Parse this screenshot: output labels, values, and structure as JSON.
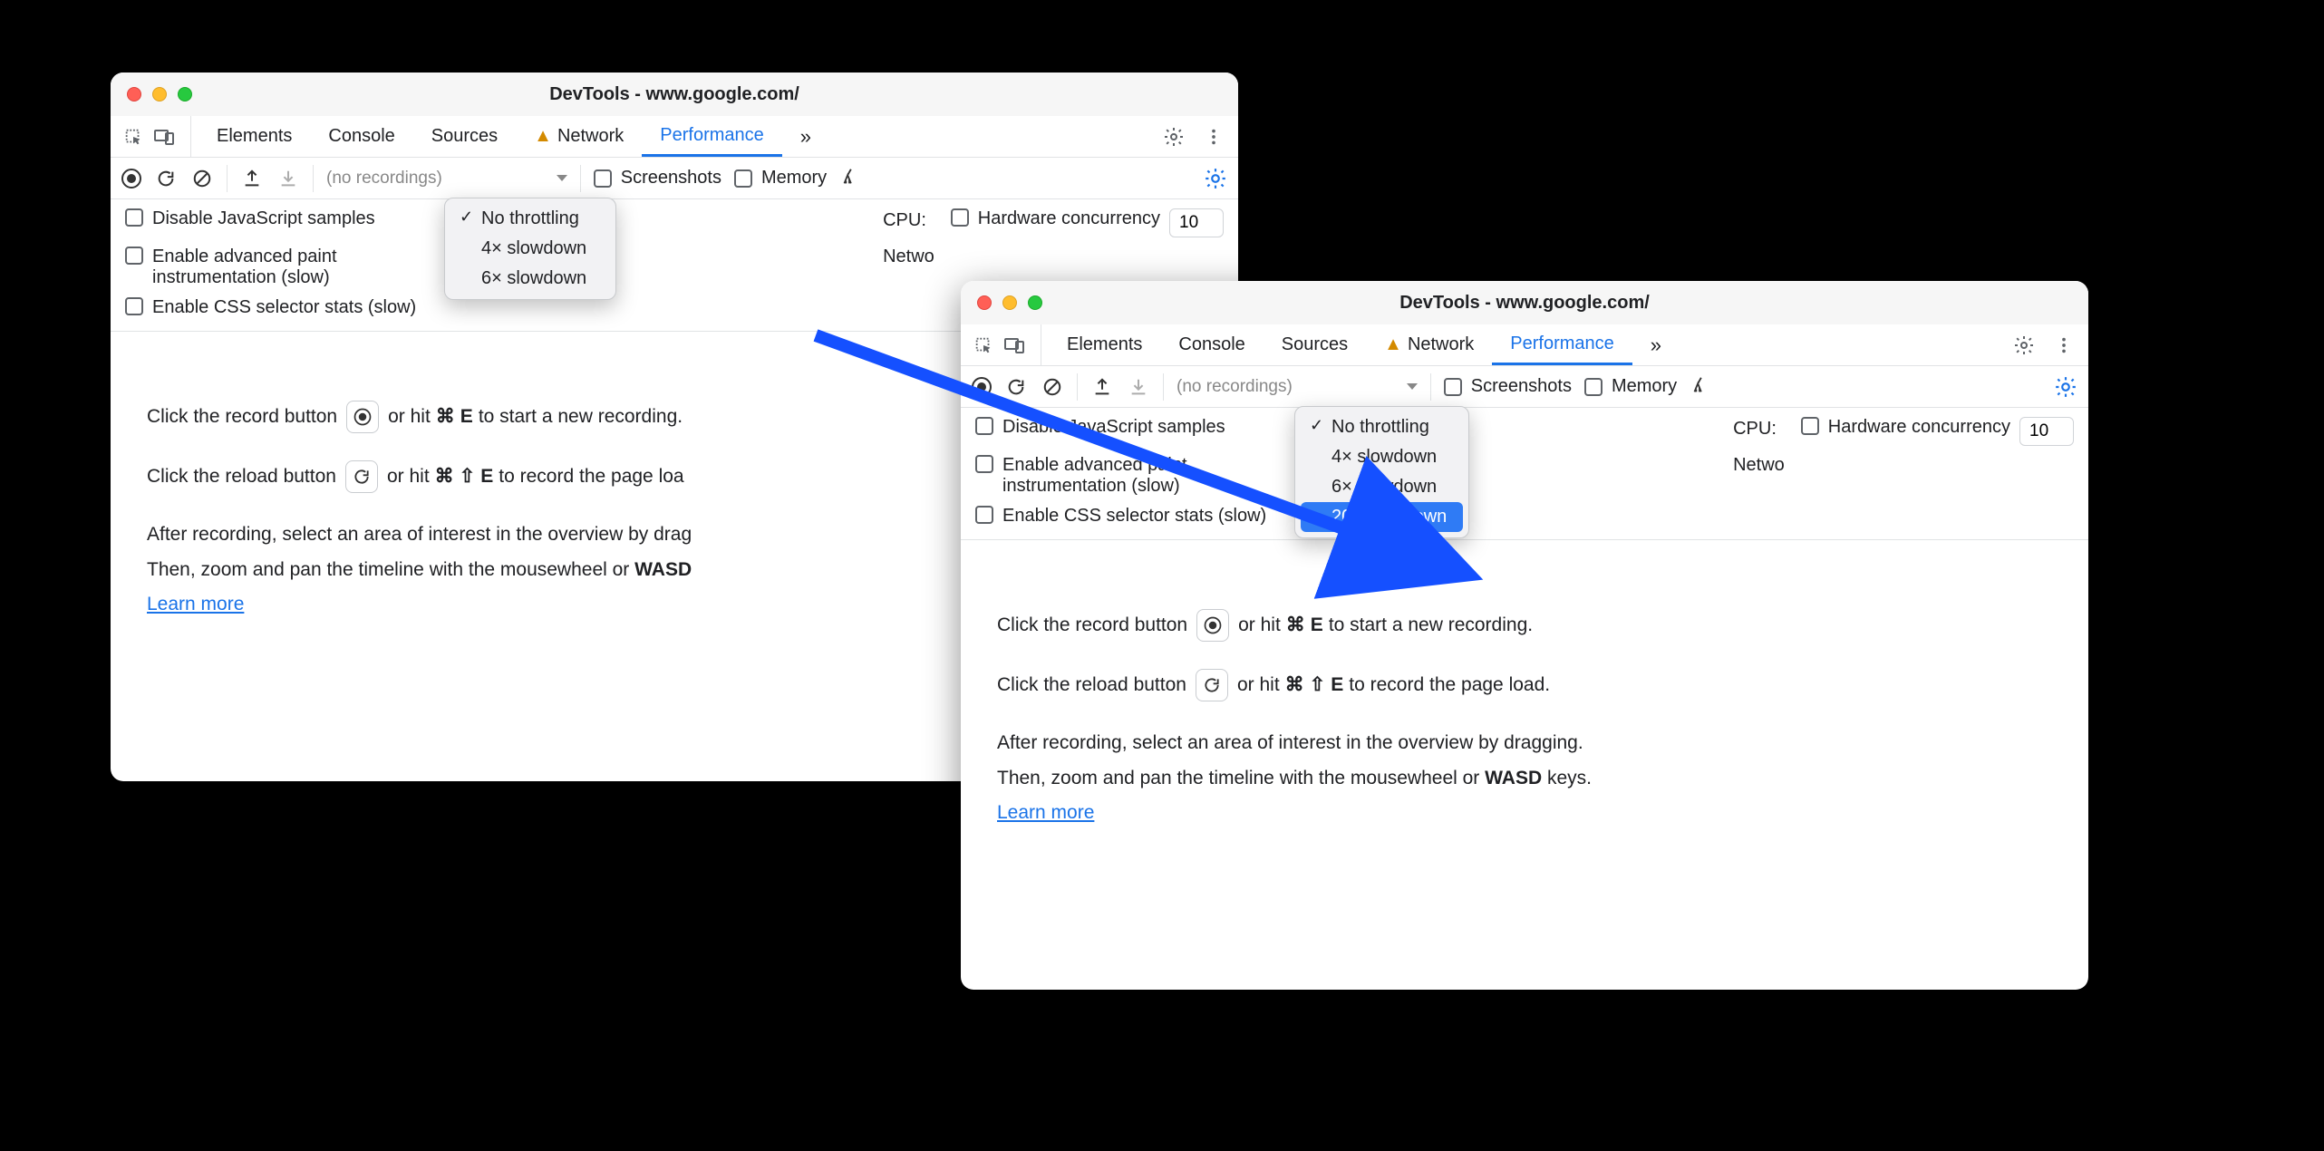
{
  "windowA": {
    "title": "DevTools - www.google.com/",
    "tabs": [
      "Elements",
      "Console",
      "Sources",
      "Network",
      "Performance"
    ],
    "activeTab": "Performance",
    "toolbar": {
      "noRecordings": "(no recordings)",
      "screenshots": "Screenshots",
      "memory": "Memory"
    },
    "settings": {
      "disableJS": "Disable JavaScript samples",
      "advPaint": "Enable advanced paint instrumentation (slow)",
      "cssSelector": "Enable CSS selector stats (slow)",
      "cpuLabel": "CPU:",
      "networkLabel": "Netwo",
      "hardwareConcurrency": "Hardware concurrency",
      "hardwareValue": "10"
    },
    "cpuDropdown": {
      "items": [
        "No throttling",
        "4× slowdown",
        "6× slowdown"
      ],
      "checkedIndex": 0,
      "highlightIndex": -1
    },
    "instructions": {
      "recordLine_pre": "Click the record button",
      "recordLine_post": "or hit",
      "recordShortcut_mod": "⌘",
      "recordShortcut_key": "E",
      "recordLine_end": "to start a new recording.",
      "reloadLine_pre": "Click the reload button",
      "reloadLine_post": "or hit",
      "reloadShortcut_mod": "⌘",
      "reloadShortcut_shift": "⇧",
      "reloadShortcut_key": "E",
      "reloadLine_end": "to record the page loa",
      "tip1": "After recording, select an area of interest in the overview by drag",
      "tip2_pre": "Then, zoom and pan the timeline with the mousewheel or ",
      "tip2_bold": "WASD",
      "learnMore": "Learn more"
    }
  },
  "windowB": {
    "title": "DevTools - www.google.com/",
    "tabs": [
      "Elements",
      "Console",
      "Sources",
      "Network",
      "Performance"
    ],
    "activeTab": "Performance",
    "toolbar": {
      "noRecordings": "(no recordings)",
      "screenshots": "Screenshots",
      "memory": "Memory"
    },
    "settings": {
      "disableJS": "Disable JavaScript samples",
      "advPaint": "Enable advanced paint instrumentation (slow)",
      "cssSelector": "Enable CSS selector stats (slow)",
      "cpuLabel": "CPU:",
      "networkLabel": "Netwo",
      "hardwareConcurrency": "Hardware concurrency",
      "hardwareValue": "10"
    },
    "cpuDropdown": {
      "items": [
        "No throttling",
        "4× slowdown",
        "6× slowdown",
        "20× slowdown"
      ],
      "checkedIndex": 0,
      "highlightIndex": 3
    },
    "instructions": {
      "recordLine_pre": "Click the record button",
      "recordLine_post": "or hit",
      "recordShortcut_mod": "⌘",
      "recordShortcut_key": "E",
      "recordLine_end": "to start a new recording.",
      "reloadLine_pre": "Click the reload button",
      "reloadLine_post": "or hit",
      "reloadShortcut_mod": "⌘",
      "reloadShortcut_shift": "⇧",
      "reloadShortcut_key": "E",
      "reloadLine_end": "to record the page load.",
      "tip1": "After recording, select an area of interest in the overview by dragging.",
      "tip2_pre": "Then, zoom and pan the timeline with the mousewheel or ",
      "tip2_bold": "WASD",
      "tip2_post": " keys.",
      "learnMore": "Learn more"
    }
  }
}
